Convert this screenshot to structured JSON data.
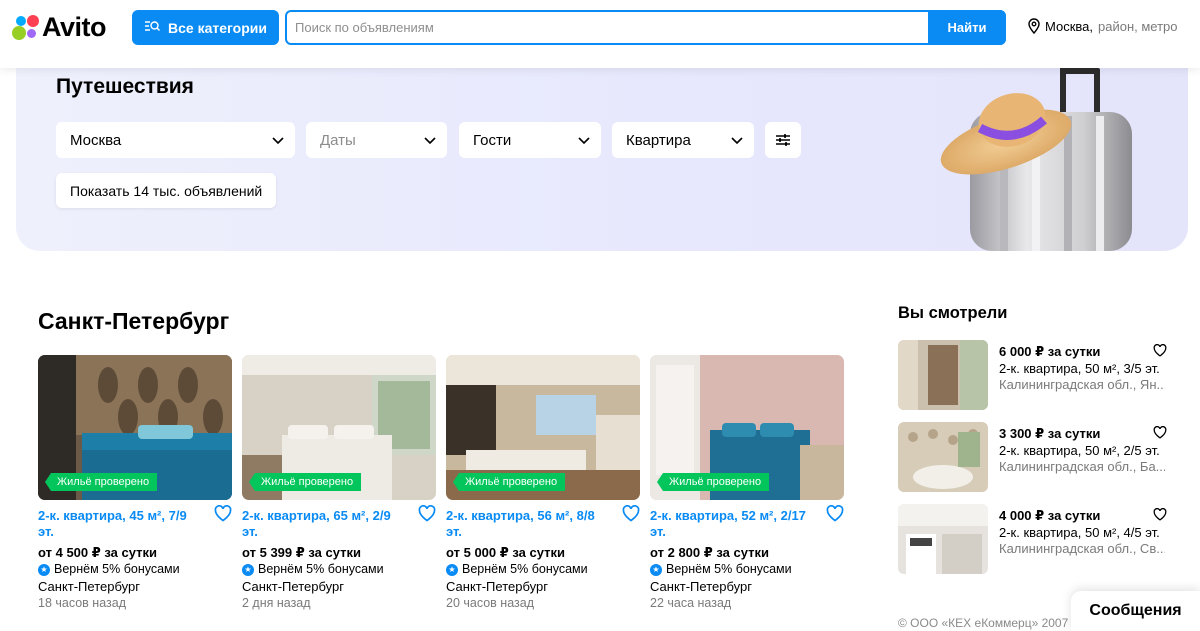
{
  "header": {
    "logo_text": "Avito",
    "categories_label": "Все категории",
    "search_placeholder": "Поиск по объявлениям",
    "search_button": "Найти",
    "location_city": "Москва,",
    "location_rest": "район, метро"
  },
  "banner": {
    "title": "Путешествия",
    "filters": {
      "city": "Москва",
      "dates": "Даты",
      "guests": "Гости",
      "type": "Квартира"
    },
    "show_button": "Показать 14 тыс. объявлений"
  },
  "section": {
    "title": "Санкт-Петербург",
    "cards": [
      {
        "badge": "Жильё проверено",
        "title": "2-к. квартира, 45 м², 7/9 эт.",
        "price": "от 4 500 ₽ за сутки",
        "bonus": "Вернём 5% бонусами",
        "city": "Санкт-Петербург",
        "ago": "18 часов назад"
      },
      {
        "badge": "Жильё проверено",
        "title": "2-к. квартира, 65 м², 2/9 эт.",
        "price": "от 5 399 ₽ за сутки",
        "bonus": "Вернём 5% бонусами",
        "city": "Санкт-Петербург",
        "ago": "2 дня назад"
      },
      {
        "badge": "Жильё проверено",
        "title": "2-к. квартира, 56 м², 8/8 эт.",
        "price": "от 5 000 ₽ за сутки",
        "bonus": "Вернём 5% бонусами",
        "city": "Санкт-Петербург",
        "ago": "20 часов назад"
      },
      {
        "badge": "Жильё проверено",
        "title": "2-к. квартира, 52 м², 2/17 эт.",
        "price": "от 2 800 ₽ за сутки",
        "bonus": "Вернём 5% бонусами",
        "city": "Санкт-Петербург",
        "ago": "22 часа назад"
      }
    ]
  },
  "recently_viewed": {
    "title": "Вы смотрели",
    "items": [
      {
        "price": "6 000 ₽ за сутки",
        "desc": "2-к. квартира, 50 м², 3/5 эт.",
        "addr": "Калининградская обл., Ян..."
      },
      {
        "price": "3 300 ₽ за сутки",
        "desc": "2-к. квартира, 50 м², 2/5 эт.",
        "addr": "Калининградская обл., Ба..."
      },
      {
        "price": "4 000 ₽ за сутки",
        "desc": "2-к. квартира, 50 м², 4/5 эт.",
        "addr": "Калининградская обл., Св..."
      }
    ]
  },
  "footer": {
    "copyright": "© ООО «КЕХ еКоммерц» 2007"
  },
  "messages_button": "Сообщения",
  "colors": {
    "accent": "#0a8bf4",
    "verified_badge": "#02c65b",
    "banner_bg": "#e7e8fd"
  }
}
